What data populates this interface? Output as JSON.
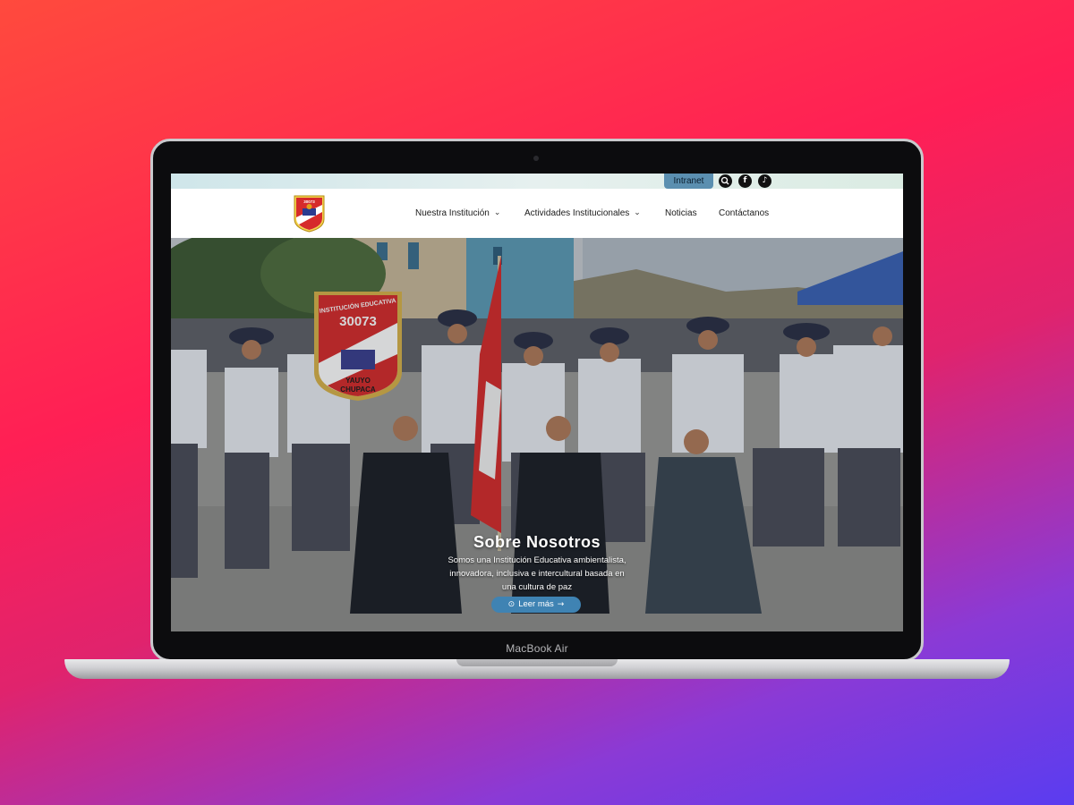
{
  "device": {
    "label": "MacBook Air"
  },
  "topbar": {
    "intranet_label": "Intranet",
    "icons": [
      "search-icon",
      "facebook-icon",
      "tiktok-icon"
    ]
  },
  "logo": {
    "number": "30073",
    "place": "YAUYO CHUPACA"
  },
  "nav": {
    "items": [
      {
        "label": "Nuestra Institución",
        "has_dropdown": true
      },
      {
        "label": "Actividades Institucionales",
        "has_dropdown": true
      },
      {
        "label": "Noticias",
        "has_dropdown": false
      },
      {
        "label": "Contáctanos",
        "has_dropdown": false
      }
    ]
  },
  "hero": {
    "title": "Sobre Nosotros",
    "text": "Somos una Institución Educativa ambientalista, innovadora, inclusiva e intercultural basada en una cultura de paz",
    "cta_label": "Leer más",
    "banner_line1": "INSTITUCIÓN EDUCATIVA",
    "banner_number": "30073",
    "banner_line2": "YAUYO",
    "banner_line3": "CHUPACA"
  },
  "colors": {
    "accent": "#3f83b3",
    "intranet_bg": "#5b8fb0",
    "red": "#d62b2b"
  }
}
